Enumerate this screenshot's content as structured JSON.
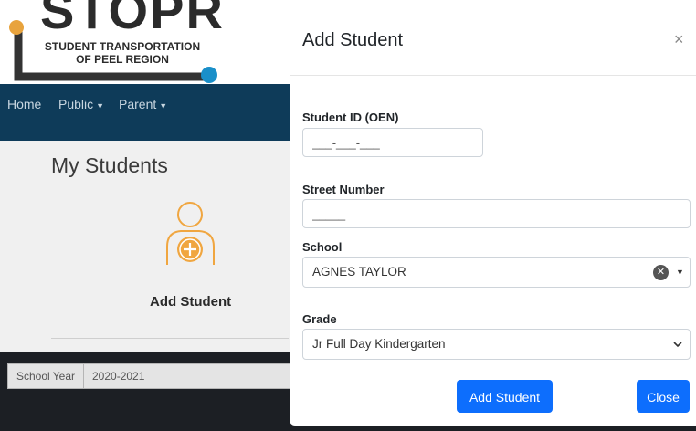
{
  "background": {
    "logo": {
      "big_text": "STOPR",
      "line1": "STUDENT TRANSPORTATION",
      "line2": "OF PEEL REGION"
    },
    "nav": {
      "home": "Home",
      "public": "Public",
      "parent": "Parent"
    },
    "page_title": "My Students",
    "add_student_label": "Add Student",
    "school_year": {
      "label": "School Year",
      "value": "2020-2021"
    }
  },
  "modal": {
    "title": "Add Student",
    "close_icon": "×",
    "student_id": {
      "label": "Student ID (OEN)",
      "placeholder": "___-___-___"
    },
    "street_number": {
      "label": "Street Number",
      "placeholder": "_____"
    },
    "school": {
      "label": "School",
      "value": "AGNES TAYLOR"
    },
    "grade": {
      "label": "Grade",
      "value": "Jr Full Day Kindergarten"
    },
    "buttons": {
      "add": "Add Student",
      "close": "Close"
    }
  },
  "colors": {
    "nav": "#0e3b59",
    "accent": "#0d6efd",
    "logo_orange": "#e8a33d",
    "logo_blue": "#1a8fc9",
    "icon_orange": "#f0a640"
  }
}
